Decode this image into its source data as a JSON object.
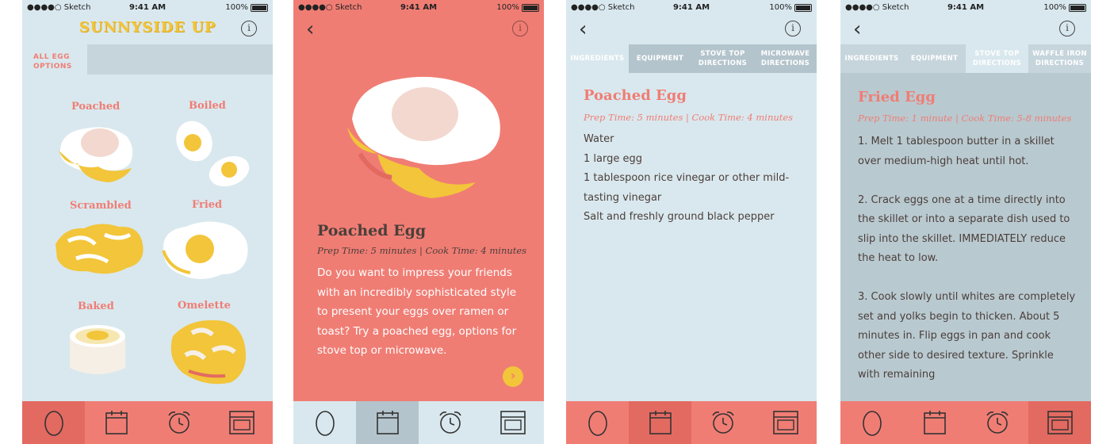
{
  "status_bar": {
    "carrier": "●●●●○ Sketch",
    "time": "9:41 AM",
    "battery": "100%"
  },
  "screen1": {
    "app_title": "SUNNYSIDE UP",
    "category_tab": "ALL EGG OPTIONS",
    "eggs": [
      "Poached",
      "Boiled",
      "Scrambled",
      "Fried",
      "Baked",
      "Omelette"
    ]
  },
  "screen2": {
    "title": "Poached Egg",
    "times": "Prep Time: 5 minutes | Cook Time: 4 minutes",
    "description": "Do you want to impress your friends with an incredibly sophisticated style to present your eggs over ramen or toast? Try a poached egg, options for stove top or microwave."
  },
  "screen3": {
    "tabs": [
      "INGREDIENTS",
      "EQUIPMENT",
      "STOVE TOP DIRECTIONS",
      "MICROWAVE DIRECTIONS"
    ],
    "title": "Poached Egg",
    "times": "Prep Time: 5 minutes | Cook Time: 4 minutes",
    "ingredients": [
      "Water",
      "1 large egg",
      "1 tablespoon rice vinegar or other mild-tasting vinegar",
      "Salt and freshly ground black pepper"
    ]
  },
  "screen4": {
    "tabs": [
      "INGREDIENTS",
      "EQUIPMENT",
      "STOVE TOP DIRECTIONS",
      "WAFFLE IRON DIRECTIONS"
    ],
    "title": "Fried Egg",
    "times": "Prep Time: 1 minute | Cook Time: 5-8 minutes",
    "steps": [
      "1. Melt 1 tablespoon butter in a skillet over medium-high heat until hot.",
      "2. Crack eggs one at a time directly into the skillet or into a separate dish used to slip into the skillet. IMMEDIATELY reduce the heat to low.",
      "3. Cook slowly until whites are completely set and yolks begin to thicken. About 5 minutes in. Flip eggs in pan and cook other side to desired texture. Sprinkle with remaining"
    ]
  },
  "tabbar": {
    "icons": [
      "egg-icon",
      "calendar-icon",
      "alarm-clock-icon",
      "oven-icon"
    ]
  },
  "colors": {
    "coral": "#f07d74",
    "pale_blue": "#d9e8ee",
    "yolk": "#f2c53a",
    "grey_blue": "#b4c4cc"
  }
}
